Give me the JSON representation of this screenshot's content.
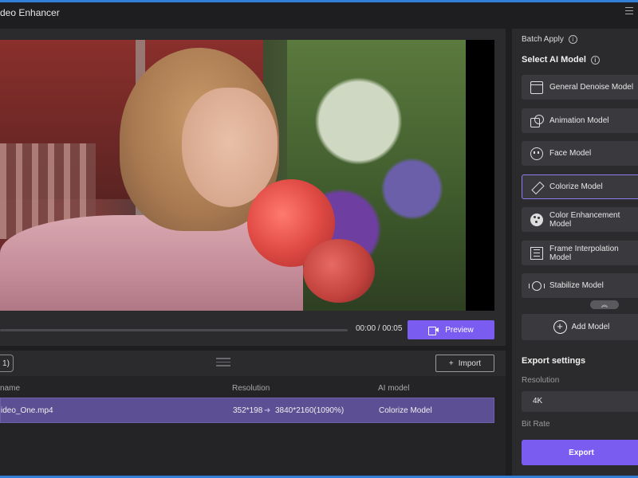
{
  "app": {
    "title": "deo Enhancer"
  },
  "player": {
    "time": "00:00 / 00:05",
    "progress": 0,
    "preview_label": "Preview"
  },
  "list": {
    "count": "1)",
    "import_label": "Import",
    "headers": {
      "name": "name",
      "resolution": "Resolution",
      "model": "AI model"
    },
    "rows": [
      {
        "name": "ideo_One.mp4",
        "source_res": "352*198",
        "target_res": "3840*2160(1090%)",
        "model": "Colorize Model"
      }
    ]
  },
  "sidebar": {
    "batch_label": "Batch Apply",
    "select_title": "Select AI Model",
    "models": [
      {
        "label": "General Denoise Model",
        "icon": "clapperboard-icon"
      },
      {
        "label": "Animation Model",
        "icon": "shapes-icon"
      },
      {
        "label": "Face Model",
        "icon": "face-icon"
      },
      {
        "label": "Colorize Model",
        "icon": "brush-icon",
        "selected": true
      },
      {
        "label": "Color Enhancement Model",
        "icon": "palette-icon"
      },
      {
        "label": "Frame Interpolation Model",
        "icon": "frames-icon"
      },
      {
        "label": "Stabilize Model",
        "icon": "stabilize-icon"
      }
    ],
    "add_model_label": "Add Model",
    "export_title": "Export settings",
    "resolution_label": "Resolution",
    "resolution_value": "4K",
    "bitrate_label": "Bit Rate",
    "export_label": "Export"
  },
  "colors": {
    "accent": "#7a5cf0",
    "selected_row": "#5d4f94",
    "panel": "#2b2b2d"
  }
}
